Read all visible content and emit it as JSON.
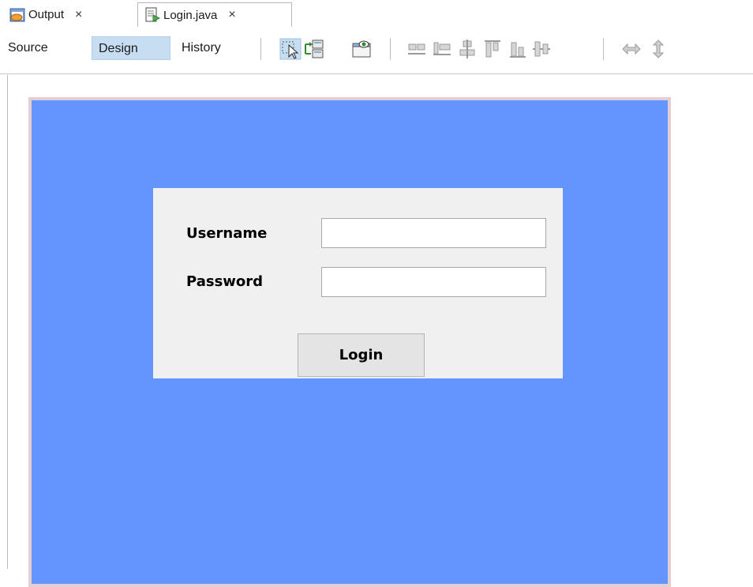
{
  "tabs": [
    {
      "label": "Output",
      "close": "×",
      "icon": "output-window-icon",
      "active": false
    },
    {
      "label": "Login.java",
      "close": "×",
      "icon": "java-file-icon",
      "active": true
    }
  ],
  "toolbar": {
    "modes": {
      "source": "Source",
      "design": "Design",
      "history": "History"
    },
    "active_mode": "Design",
    "icons": [
      "selection-mode-icon",
      "connection-mode-icon",
      "preview-design-icon",
      "align-left-icon",
      "align-right-icon",
      "center-horizontally-icon",
      "align-top-icon",
      "align-bottom-icon",
      "center-vertically-icon",
      "horizontal-resize-icon",
      "vertical-resize-icon"
    ]
  },
  "form": {
    "background_color": "#6495ff",
    "panel_color": "#f0f0f0",
    "username_label": "Username",
    "password_label": "Password",
    "username_value": "",
    "password_value": "",
    "login_label": "Login"
  }
}
